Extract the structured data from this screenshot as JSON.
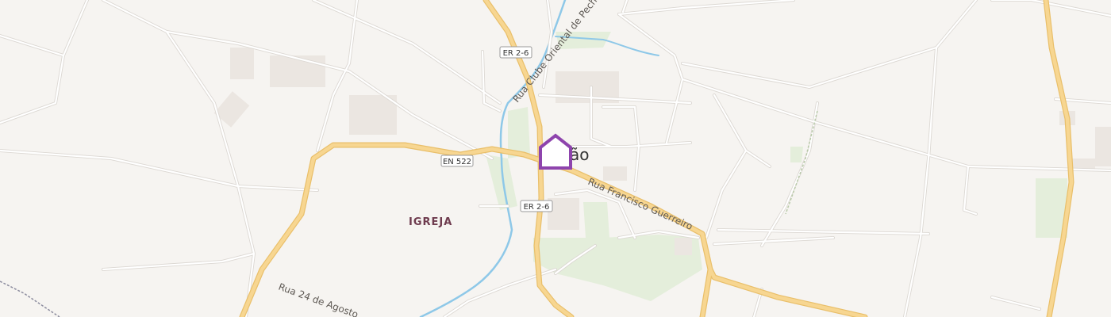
{
  "map": {
    "town_label_visible": "ão",
    "place_label": "IGREJA",
    "roads": {
      "en522": "EN 522",
      "er26_north": "ER 2-6",
      "er26_south": "ER 2-6",
      "rua_francisco": "Rua Francisco Guerreiro",
      "rua_clube": "Rua Clube Oriental de Pechão",
      "rua_24": "Rua 24 de Agosto"
    },
    "marker": {
      "icon": "home-marker-icon",
      "color": "#8e44ad"
    },
    "colors": {
      "background": "#f6f4f1",
      "major_road": "#f7d691",
      "major_road_casing": "#e9bf6a",
      "minor_road": "#ffffff",
      "minor_road_casing": "#dcd8d3",
      "river": "#8ec8e8",
      "green": "#e4eedb",
      "building": "#ebe6e1"
    }
  }
}
